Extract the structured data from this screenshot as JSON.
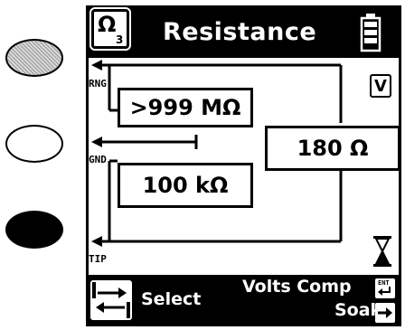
{
  "header": {
    "mode_symbol": "Ω",
    "mode_subscript": "3",
    "title": "Resistance",
    "battery_icon": "battery-full-icon"
  },
  "leads": {
    "rng_label": "RNG",
    "gnd_label": "GND",
    "tip_label": "TIP"
  },
  "readings": {
    "rng_value": ">999 MΩ",
    "gnd_value": "100 kΩ",
    "main_value": "180 Ω"
  },
  "indicators": {
    "v_badge": "V",
    "hourglass_icon": "hourglass-icon"
  },
  "footer": {
    "select_label": "Select",
    "volts_comp_label": "Volts Comp",
    "soak_label": "Soak",
    "enter_key_label": "ENT"
  },
  "colors": {
    "background": "#ffffff",
    "foreground": "#000000",
    "button_gray": "#b0b0b0"
  }
}
